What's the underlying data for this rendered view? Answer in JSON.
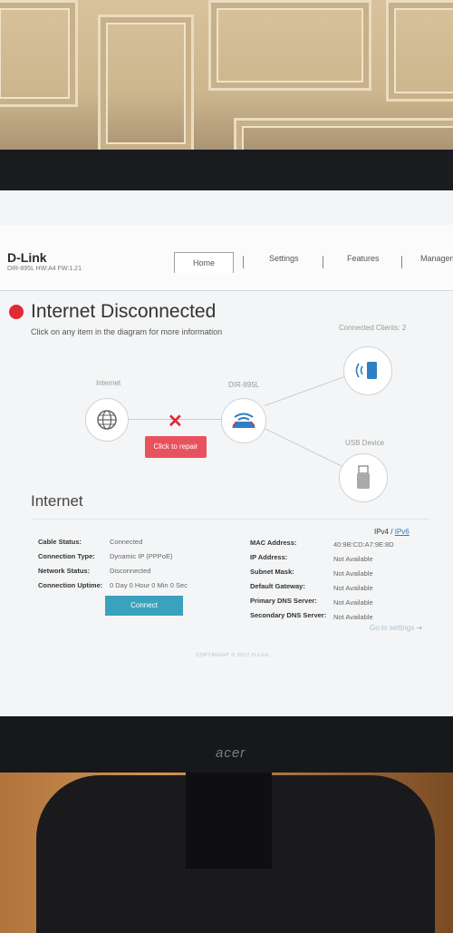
{
  "router": {
    "logo": "D-Link",
    "model_info": "DIR-895L HW:A4 FW:1.21"
  },
  "nav": {
    "home": "Home",
    "settings": "Settings",
    "features": "Features",
    "management": "Managem"
  },
  "status": {
    "title": "Internet Disconnected",
    "hint": "Click on any item in the diagram for more information",
    "color": "#e02a36"
  },
  "diagram": {
    "internet_label": "Internet",
    "router_label": "DIR-895L",
    "clients_label": "Connected Clients: 2",
    "usb_label": "USB Device",
    "repair_button": "Click to repair",
    "error_mark": "✕"
  },
  "internet_section": {
    "title": "Internet",
    "ipv4": "IPv4",
    "ipv_sep": "/",
    "ipv6": "IPv6",
    "left": [
      {
        "label": "Cable Status:",
        "value": "Connected"
      },
      {
        "label": "Connection Type:",
        "value": "Dynamic IP (PPPoE)"
      },
      {
        "label": "Network Status:",
        "value": "Disconnected"
      },
      {
        "label": "Connection Uptime:",
        "value": "0 Day 0 Hour 0 Min 0 Sec"
      }
    ],
    "right": [
      {
        "label": "MAC Address:",
        "value": "40:9B:CD:A7:9E:8D"
      },
      {
        "label": "IP Address:",
        "value": "Not Available"
      },
      {
        "label": "Subnet Mask:",
        "value": "Not Available"
      },
      {
        "label": "Default Gateway:",
        "value": "Not Available"
      },
      {
        "label": "Primary DNS Server:",
        "value": "Not Available"
      },
      {
        "label": "Secondary DNS Server:",
        "value": "Not Available"
      }
    ],
    "connect_button": "Connect",
    "goto_settings": "Go to settings ➜"
  },
  "footer": {
    "copyright": "COPYRIGHT © 2017 D-Link"
  },
  "monitor": {
    "brand": "acer"
  }
}
